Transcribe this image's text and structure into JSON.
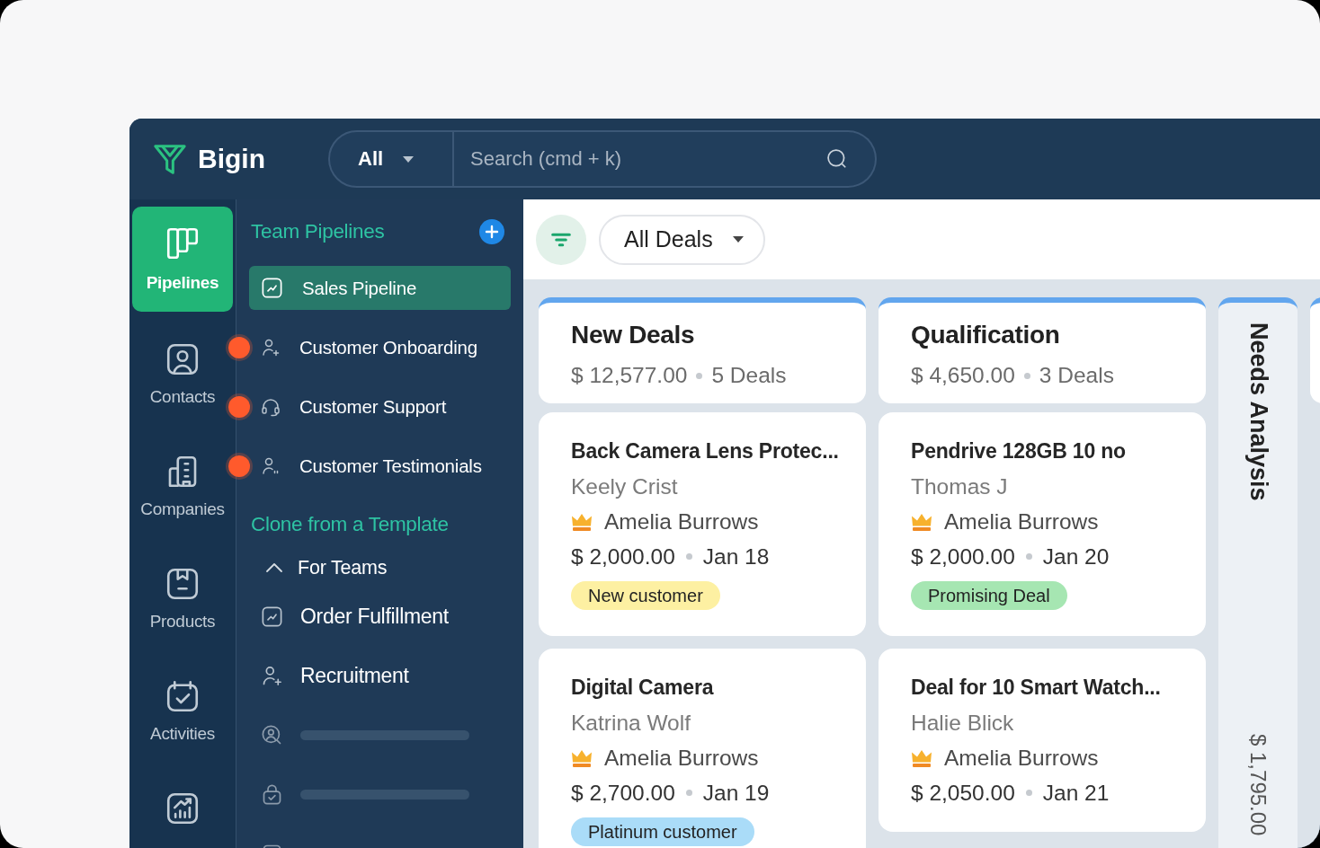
{
  "header": {
    "logo": "Bigin",
    "search": {
      "scope": "All",
      "placeholder": "Search (cmd + k)"
    }
  },
  "nav": [
    {
      "label": "Pipelines",
      "selected": true
    },
    {
      "label": "Contacts",
      "selected": false
    },
    {
      "label": "Companies",
      "selected": false
    },
    {
      "label": "Products",
      "selected": false
    },
    {
      "label": "Activities",
      "selected": false
    },
    {
      "selected": false
    }
  ],
  "sidebar": {
    "team_pipelines": {
      "title": "Team Pipelines",
      "items": [
        {
          "label": "Sales Pipeline",
          "selected": true,
          "hotspot": false
        },
        {
          "label": "Customer Onboarding",
          "selected": false,
          "hotspot": true
        },
        {
          "label": "Customer Support",
          "selected": false,
          "hotspot": true
        },
        {
          "label": "Customer Testimonials",
          "selected": false,
          "hotspot": true
        }
      ]
    },
    "templates": {
      "title": "Clone from a Template",
      "groups": [
        {
          "label": "For Teams",
          "expanded": true,
          "children": [
            {
              "kind": "item",
              "label": "Order Fulfillment"
            },
            {
              "kind": "item",
              "label": "Recruitment"
            },
            {
              "kind": "placeholder"
            },
            {
              "kind": "placeholder"
            },
            {
              "kind": "placeholder"
            }
          ]
        }
      ]
    }
  },
  "toolbar": {
    "view": "All Deals"
  },
  "board": {
    "columns": [
      {
        "kind": "expanded",
        "title": "New Deals",
        "amount": "$ 12,577.00",
        "count": "5 Deals",
        "deals": [
          {
            "title": "Back Camera Lens Protec...",
            "contact": "Keely Crist",
            "owner": "Amelia Burrows",
            "amount": "$ 2,000.00",
            "date": "Jan 18",
            "tag": {
              "label": "New customer",
              "color": "#fdf0a2"
            }
          },
          {
            "title": "Digital Camera",
            "contact": "Katrina Wolf",
            "owner": "Amelia Burrows",
            "amount": "$ 2,700.00",
            "date": "Jan 19",
            "tag": {
              "label": "Platinum customer",
              "color": "#aadcf8"
            }
          }
        ]
      },
      {
        "kind": "expanded",
        "title": "Qualification",
        "amount": "$ 4,650.00",
        "count": "3 Deals",
        "deals": [
          {
            "title": "Pendrive 128GB 10 no",
            "contact": "Thomas J",
            "owner": "Amelia Burrows",
            "amount": "$ 2,000.00",
            "date": "Jan 20",
            "tag": {
              "label": "Promising Deal",
              "color": "#a6e6b2"
            }
          },
          {
            "title": "Deal for 10 Smart Watch...",
            "contact": "Halie Blick",
            "owner": "Amelia Burrows",
            "amount": "$ 2,050.00",
            "date": "Jan 21"
          }
        ]
      },
      {
        "kind": "collapsed",
        "title": "Needs Analysis",
        "amount": "$ 1,795.00"
      }
    ]
  }
}
